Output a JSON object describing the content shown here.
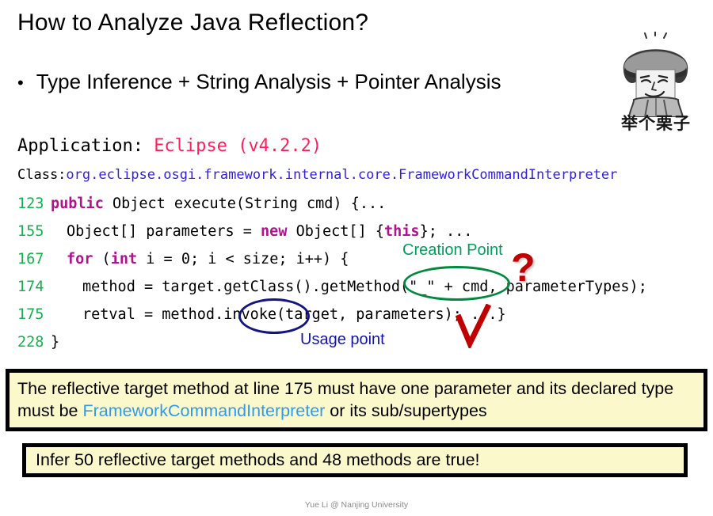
{
  "slide": {
    "title": "How to Analyze Java Reflection?",
    "bullet_marker": "•",
    "bullet": "Type Inference + String Analysis + Pointer Analysis",
    "footer": "Yue Li @ Nanjing University"
  },
  "meme": {
    "caption": "举个栗子",
    "alt": "meme-character-with-fur-hat"
  },
  "application": {
    "label": "Application: ",
    "value": "Eclipse (v4.2.2)"
  },
  "class_decl": {
    "label": "Class:",
    "value": "org.eclipse.osgi.framework.internal.core.FrameworkCommandInterpreter"
  },
  "code": {
    "lines": [
      {
        "no": "123",
        "indent": 0,
        "parts": [
          {
            "t": "public",
            "k": true
          },
          {
            "t": " Object execute(String cmd) {...",
            "k": false
          }
        ]
      },
      {
        "no": "155",
        "indent": 1,
        "parts": [
          {
            "t": "Object[] parameters = ",
            "k": false
          },
          {
            "t": "new",
            "k": true
          },
          {
            "t": " Object[] {",
            "k": false
          },
          {
            "t": "this",
            "k": true
          },
          {
            "t": "}; ...",
            "k": false
          }
        ]
      },
      {
        "no": "167",
        "indent": 1,
        "parts": [
          {
            "t": "for",
            "k": true
          },
          {
            "t": " (",
            "k": false
          },
          {
            "t": "int",
            "k": true
          },
          {
            "t": " i = 0; i < size; i++) {",
            "k": false
          }
        ]
      },
      {
        "no": "174",
        "indent": 2,
        "parts": [
          {
            "t": "method = target.getClass().getMethod(\"_\" + cmd, parameterTypes);",
            "k": false
          }
        ]
      },
      {
        "no": "175",
        "indent": 2,
        "parts": [
          {
            "t": "retval = method.invoke(target, parameters); ...}",
            "k": false
          }
        ]
      },
      {
        "no": "228",
        "indent": 0,
        "parts": [
          {
            "t": "}",
            "k": false
          }
        ]
      }
    ]
  },
  "annotations": {
    "creation_point": "Creation Point",
    "usage_point": "Usage point",
    "question_mark": "?",
    "check_mark": "✓"
  },
  "callouts": {
    "constraint_part1": "The reflective target method at line 175 must have one parameter and its declared type must be ",
    "constraint_type": "FrameworkCommandInterpreter",
    "constraint_part2": " or its sub/supertypes",
    "result": "Infer 50 reflective target methods and 48 methods are true!"
  },
  "colors": {
    "line_number_green": "#14b24c",
    "keyword_magenta": "#b0138c",
    "app_pink": "#ff1f5a",
    "class_blue": "#3322dd",
    "creation_green": "#00a05a",
    "usage_blue": "#1414aa",
    "question_red": "#c00000",
    "check_red": "#c00000",
    "callout_bg": "#fbf8cc",
    "type_blue": "#2e9bf0"
  }
}
